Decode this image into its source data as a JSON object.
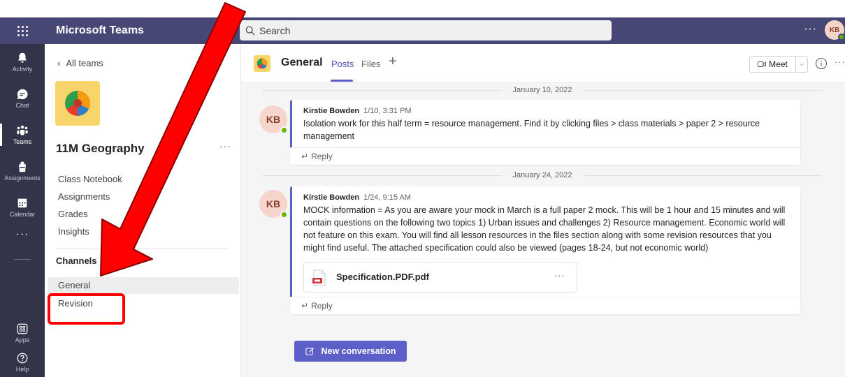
{
  "app": {
    "title": "Microsoft Teams",
    "user_initials": "KB"
  },
  "search": {
    "placeholder": "Search"
  },
  "titlebar": {
    "more": "···"
  },
  "rail": {
    "items": [
      {
        "label": "Activity",
        "icon": "bell-icon"
      },
      {
        "label": "Chat",
        "icon": "chat-icon"
      },
      {
        "label": "Teams",
        "icon": "teams-icon",
        "active": true
      },
      {
        "label": "Assignments",
        "icon": "assignments-icon"
      },
      {
        "label": "Calendar",
        "icon": "calendar-icon"
      }
    ],
    "more": "···",
    "bottom": [
      {
        "label": "Apps",
        "icon": "apps-icon"
      },
      {
        "label": "Help",
        "icon": "help-icon"
      }
    ]
  },
  "team": {
    "back_label": "All teams",
    "name": "11M Geography",
    "more": "···",
    "nav": [
      "Class Notebook",
      "Assignments",
      "Grades",
      "Insights"
    ],
    "channels_label": "Channels",
    "channels": [
      {
        "name": "General",
        "active": true
      },
      {
        "name": "Revision",
        "active": false
      }
    ]
  },
  "channel": {
    "title": "General",
    "tabs": [
      "Posts",
      "Files"
    ],
    "active_tab": "Posts",
    "meet_label": "Meet",
    "more": "···"
  },
  "posts": [
    {
      "date": "January 10, 2022",
      "author": "Kirstie Bowden",
      "initials": "KB",
      "time": "1/10, 3:31 PM",
      "message": "Isolation work for this half term = resource management. Find it by clicking files > class materials > paper 2 > resource management",
      "reply_label": "Reply"
    },
    {
      "date": "January 24, 2022",
      "author": "Kirstie Bowden",
      "initials": "KB",
      "time": "1/24, 9:15 AM",
      "message": "MOCK information = As you are aware your mock in March is a full paper 2 mock. This will be 1 hour and 15 minutes and will contain questions on the following two topics 1) Urban issues and challenges 2) Resource management. Economic world will not feature on this exam. You will find all lesson resources in the files section along with some revision resources that you might find useful. The attached specification could also be viewed (pages 18-24, but not economic world)",
      "attachment": {
        "name": "Specification.PDF.pdf",
        "more": "···"
      },
      "reply_label": "Reply"
    }
  ],
  "new_conversation_label": "New conversation",
  "colors": {
    "titlebar": "#464775",
    "rail": "#33344a",
    "accent": "#5b5fc7",
    "annotation_red": "#ff0000",
    "presence_green": "#6bb700"
  }
}
